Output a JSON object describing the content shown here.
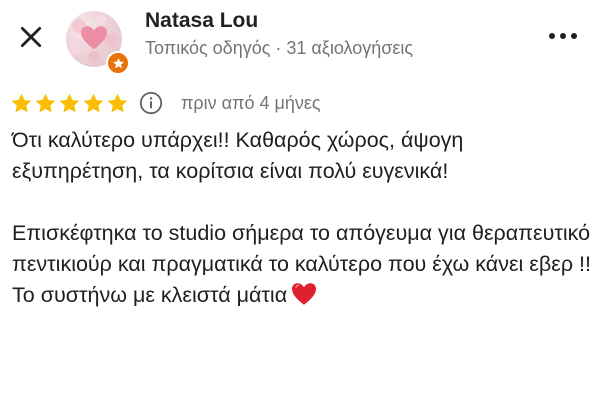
{
  "header": {
    "close_icon": "close-icon",
    "user_name": "Natasa Lou",
    "user_meta": "Τοπικός οδηγός · 31 αξιολογήσεις",
    "badge_icon": "local-guide-star-icon",
    "more_icon": "more-horizontal-icon"
  },
  "review": {
    "rating": 5,
    "rating_max": 5,
    "star_color": "#fbbc04",
    "info_icon": "info-icon",
    "date": "πριν από 4 μήνες",
    "paragraphs": [
      "Ότι καλύτερο υπάρχει!! Καθαρός χώρος, άψογη εξυπηρέτηση, τα κορίτσια είναι πολύ  ευγενικά!",
      "Επισκέφτηκα το studio σήμερα το απόγευμα για θεραπευτικό πεντικιούρ και πραγματικά το καλύτερο που έχω κάνει εβερ !! Το συστήνω με κλειστά μάτια"
    ],
    "trailing_emoji": "red-heart-icon"
  },
  "colors": {
    "badge": "#e8710a",
    "secondary_text": "#70757a",
    "heart": "#e0202e"
  }
}
